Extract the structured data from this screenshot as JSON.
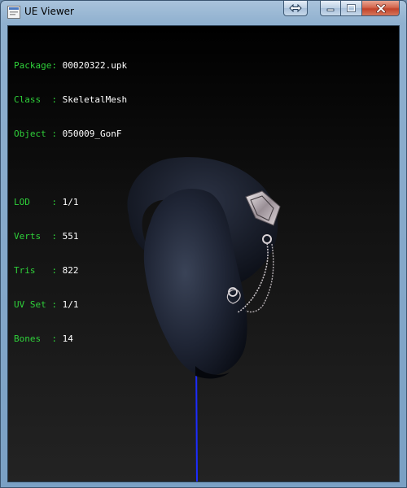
{
  "window": {
    "title": "UE Viewer",
    "icon": "ue-viewer-app-icon",
    "controls": [
      "swap-icon",
      "minimize-icon",
      "maximize-icon",
      "close-icon"
    ]
  },
  "info_panel": {
    "package": {
      "label": "Package:",
      "value": "00020322.upk"
    },
    "class": {
      "label": "Class  :",
      "value": "SkeletalMesh"
    },
    "object": {
      "label": "Object :",
      "value": "050009_GonF"
    },
    "lod": {
      "label": "LOD    :",
      "value": "1/1"
    },
    "verts": {
      "label": "Verts  :",
      "value": "551"
    },
    "tris": {
      "label": "Tris   :",
      "value": "822"
    },
    "uvset": {
      "label": "UV Set :",
      "value": "1/1"
    },
    "bones": {
      "label": "Bones  :",
      "value": "14"
    }
  },
  "colors": {
    "label_green": "#2fd13a",
    "value_white": "#ffffff",
    "axis_blue": "#1c2cff"
  }
}
